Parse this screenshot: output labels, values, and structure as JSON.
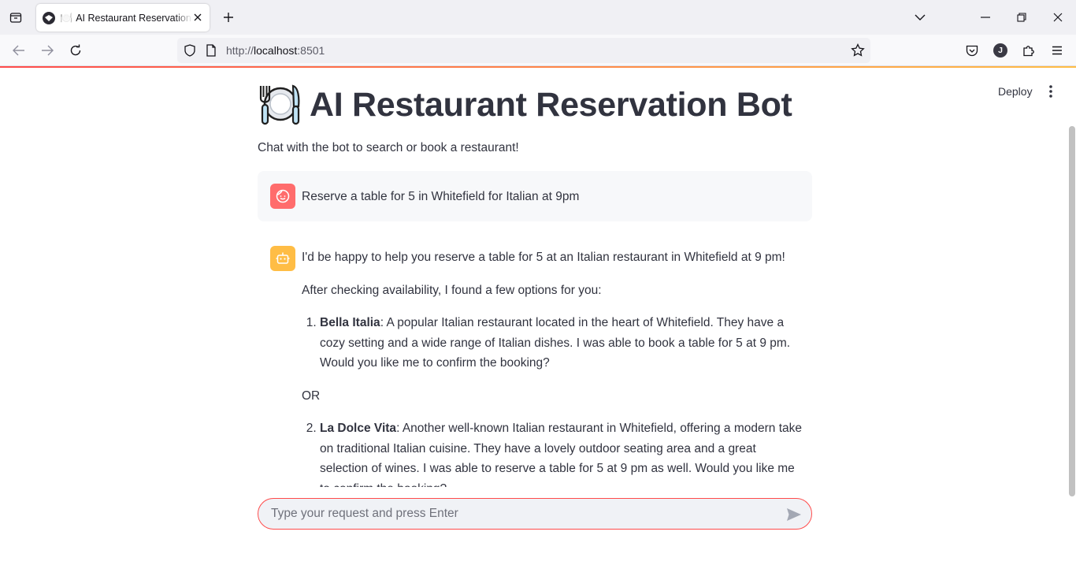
{
  "browser": {
    "tab_title": "AI Restaurant Reservation Bot",
    "tab_emoji": "🍽️",
    "url_scheme": "http://",
    "url_host": "localhost",
    "url_port": ":8501",
    "profile_initial": "J"
  },
  "app": {
    "deploy_label": "Deploy",
    "title": "AI Restaurant Reservation Bot",
    "subtitle": "Chat with the bot to search or book a restaurant!"
  },
  "chat": {
    "user_message": "Reserve a table for 5 in Whitefield for Italian at 9pm",
    "bot": {
      "intro": "I'd be happy to help you reserve a table for 5 at an Italian restaurant in Whitefield at 9 pm!",
      "lead": "After checking availability, I found a few options for you:",
      "options": [
        {
          "number": "1",
          "name": "Bella Italia",
          "description": ": A popular Italian restaurant located in the heart of Whitefield. They have a cozy setting and a wide range of Italian dishes. I was able to book a table for 5 at 9 pm. Would you like me to confirm the booking?"
        },
        {
          "number": "2",
          "name": "La Dolce Vita",
          "description": ": Another well-known Italian restaurant in Whitefield, offering a modern take on traditional Italian cuisine. They have a lovely outdoor seating area and a great selection of wines. I was able to reserve a table for 5 at 9 pm as well. Would you like me to confirm the booking?"
        }
      ],
      "separator": "OR"
    },
    "input_placeholder": "Type your request and press Enter"
  },
  "colors": {
    "accent": "#ff4b4b",
    "user_avatar": "#ff6c6c",
    "bot_avatar": "#ffbd45",
    "text": "#31333f"
  }
}
